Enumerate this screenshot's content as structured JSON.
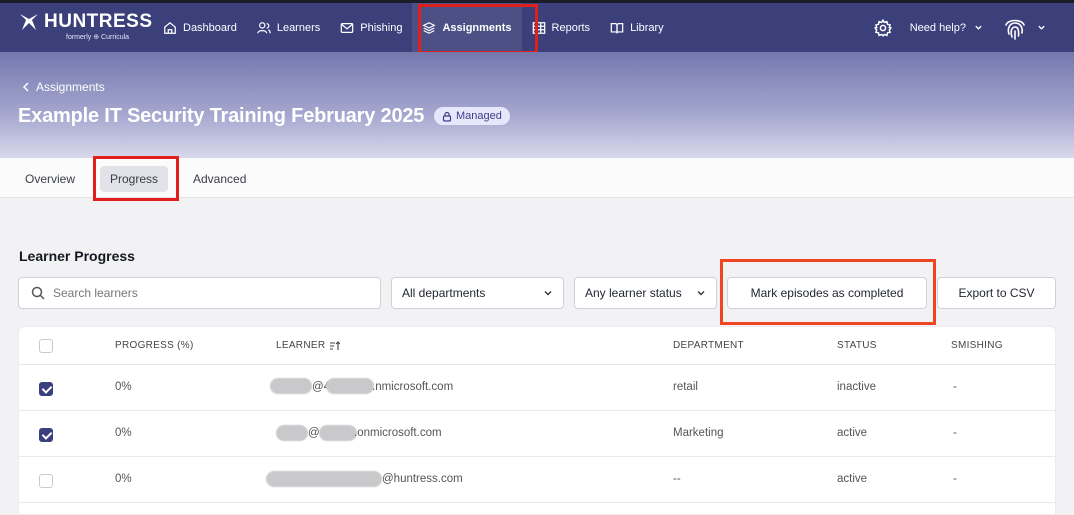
{
  "brand": {
    "name": "HUNTRESS",
    "sub": "formerly ⊕ Curricula"
  },
  "nav": [
    {
      "label": "Dashboard",
      "icon": "home-icon"
    },
    {
      "label": "Learners",
      "icon": "users-icon"
    },
    {
      "label": "Phishing",
      "icon": "mail-icon"
    },
    {
      "label": "Assignments",
      "icon": "layers-icon",
      "active": true
    },
    {
      "label": "Reports",
      "icon": "table-icon"
    },
    {
      "label": "Library",
      "icon": "book-icon"
    }
  ],
  "topright": {
    "help_label": "Need help?"
  },
  "breadcrumb": {
    "label": "Assignments"
  },
  "page": {
    "title": "Example IT Security Training February 2025",
    "badge": "Managed"
  },
  "tabs": [
    {
      "label": "Overview"
    },
    {
      "label": "Progress",
      "active": true
    },
    {
      "label": "Advanced"
    }
  ],
  "section": {
    "title": "Learner Progress"
  },
  "filters": {
    "search_placeholder": "Search learners",
    "department": "All departments",
    "status": "Any learner status",
    "mark_button": "Mark episodes as completed",
    "export_button": "Export to CSV"
  },
  "table": {
    "headers": [
      "PROGRESS (%)",
      "LEARNER",
      "DEPARTMENT",
      "STATUS",
      "SMISHING"
    ],
    "rows": [
      {
        "checked": true,
        "progress": "0%",
        "learner_visible": "@4   .nmicrosoft.com",
        "learner_a": "@4",
        "learner_b": ".nmicrosoft.com",
        "department": "retail",
        "status": "inactive",
        "smishing": "-"
      },
      {
        "checked": true,
        "progress": "0%",
        "learner_a": "@",
        "learner_b": ".onmicrosoft.com",
        "department": "Marketing",
        "status": "active",
        "smishing": "-"
      },
      {
        "checked": false,
        "progress": "0%",
        "learner_a": "",
        "learner_b": "@huntress.com",
        "department": "--",
        "status": "active",
        "smishing": "-"
      }
    ]
  },
  "colors": {
    "nav_bg": "#3b3f7a",
    "highlight_red": "#e0201c",
    "highlight_orange": "#ee4622"
  }
}
